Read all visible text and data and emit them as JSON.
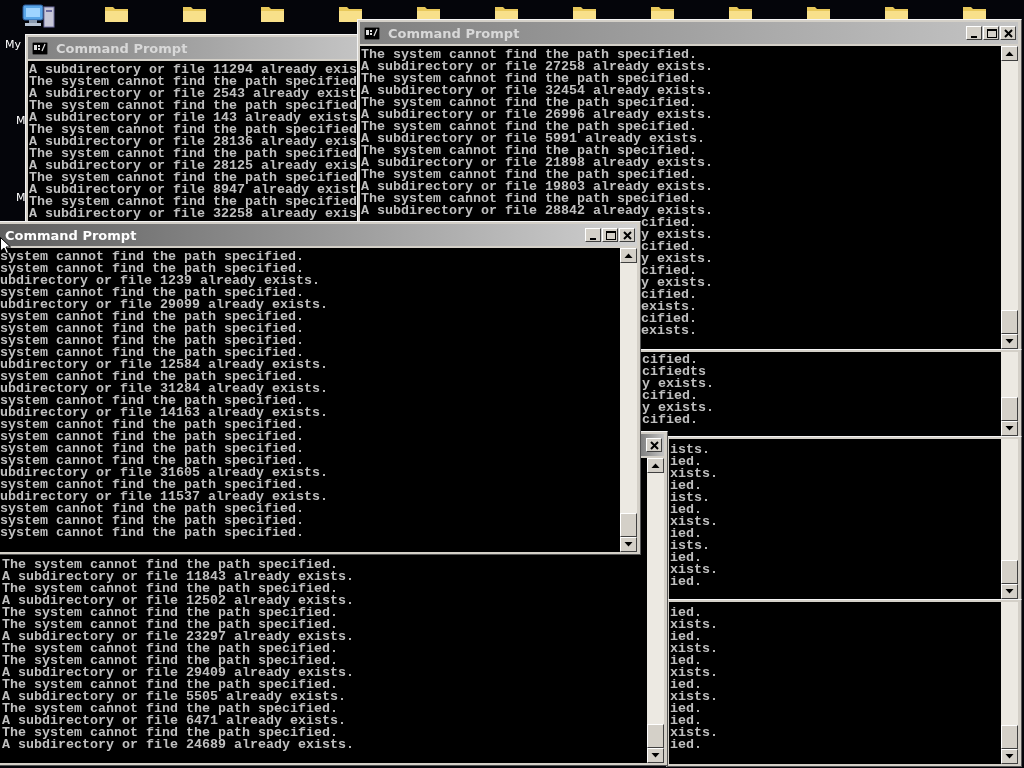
{
  "desktop": {
    "icons": [
      {
        "kind": "computer"
      },
      {
        "kind": "folder"
      },
      {
        "kind": "folder"
      },
      {
        "kind": "folder"
      },
      {
        "kind": "folder"
      },
      {
        "kind": "folder"
      },
      {
        "kind": "folder"
      },
      {
        "kind": "folder"
      },
      {
        "kind": "folder"
      },
      {
        "kind": "folder"
      },
      {
        "kind": "folder"
      },
      {
        "kind": "folder"
      },
      {
        "kind": "folder"
      }
    ],
    "labels": [
      "My",
      "M",
      "M"
    ]
  },
  "windows": [
    {
      "title": "Command Prompt",
      "active": false,
      "app_icon": true,
      "lines": [
        "A subdirectory or file 11294 already exis",
        "The system cannot find the path specified",
        "A subdirectory or file 2543 already exist",
        "The system cannot find the path specified",
        "A subdirectory or file 143 already exists",
        "The system cannot find the path specified",
        "A subdirectory or file 28136 already exis",
        "The system cannot find the path specified",
        "A subdirectory or file 28125 already exis",
        "The system cannot find the path specified",
        "A subdirectory or file 8947 already exist",
        "The system cannot find the path specified",
        "A subdirectory or file 32258 already exis"
      ]
    },
    {
      "title": "Command Prompt",
      "active": false,
      "app_icon": true,
      "controls": [
        {
          "kind": "minimize"
        },
        {
          "kind": "maximize"
        },
        {
          "kind": "close"
        }
      ],
      "lines": [
        "The system cannot find the path specified.",
        "A subdirectory or file 27258 already exists.",
        "The system cannot find the path specified.",
        "A subdirectory or file 32454 already exists.",
        "The system cannot find the path specified.",
        "A subdirectory or file 26996 already exists.",
        "The system cannot find the path specified.",
        "A subdirectory or file 5991 already exists.",
        "The system cannot find the path specified.",
        "A subdirectory or file 21898 already exists.",
        "The system cannot find the path specified.",
        "A subdirectory or file 19803 already exists.",
        "The system cannot find the path specified.",
        "A subdirectory or file 28842 already exists."
      ],
      "partial_lines": [
        "cified.",
        "y exists.",
        "cified.",
        "y exists.",
        "cified.",
        "y exists.",
        "cified.",
        "exists.",
        "cified.",
        "exists."
      ]
    },
    {
      "title": "Command Prompt",
      "active": true,
      "controls": [
        {
          "kind": "minimize"
        },
        {
          "kind": "maximize"
        },
        {
          "kind": "close"
        }
      ],
      "lines": [
        "system cannot find the path specified.",
        "system cannot find the path specified.",
        "ubdirectory or file 1239 already exists.",
        "system cannot find the path specified.",
        "ubdirectory or file 29099 already exists.",
        "system cannot find the path specified.",
        "system cannot find the path specified.",
        "system cannot find the path specified.",
        "system cannot find the path specified.",
        "ubdirectory or file 12584 already exists.",
        "system cannot find the path specified.",
        "ubdirectory or file 31284 already exists.",
        "system cannot find the path specified.",
        "ubdirectory or file 14163 already exists.",
        "system cannot find the path specified.",
        "system cannot find the path specified.",
        "system cannot find the path specified.",
        "system cannot find the path specified.",
        "ubdirectory or file 31605 already exists.",
        "system cannot find the path specified.",
        "ubdirectory or file 11537 already exists.",
        "system cannot find the path specified.",
        "system cannot find the path specified.",
        "system cannot find the path specified."
      ]
    },
    {
      "controls": [
        {
          "kind": "close"
        }
      ],
      "lines": [
        "The system cannot find the path specified.",
        "A subdirectory or file 11843 already exists.",
        "The system cannot find the path specified.",
        "A subdirectory or file 12502 already exists.",
        "The system cannot find the path specified.",
        "The system cannot find the path specified.",
        "A subdirectory or file 23297 already exists.",
        "The system cannot find the path specified.",
        "The system cannot find the path specified.",
        "A subdirectory or file 29409 already exists.",
        "The system cannot find the path specified.",
        "A subdirectory or file 5505 already exists.",
        "The system cannot find the path specified.",
        "A subdirectory or file 6471 already exists.",
        "The system cannot find the path specified.",
        "A subdirectory or file 24689 already exists."
      ]
    },
    {
      "lines": [
        "cified.",
        "cifiedts",
        "y exists.",
        "cified.",
        "y exists.",
        "cified."
      ]
    },
    {
      "lines": [
        "ists.",
        "ied.",
        "xists.",
        "ied.",
        "ists.",
        "ied.",
        "xists.",
        "ied.",
        "ists.",
        "ied.",
        "xists.",
        "ied."
      ]
    },
    {
      "lines": [
        "ied.",
        "xists.",
        "ied.",
        "xists.",
        "ied.",
        "xists.",
        "ied.",
        "xists.",
        "ied.",
        "ied.",
        "xists.",
        "ied."
      ]
    }
  ]
}
